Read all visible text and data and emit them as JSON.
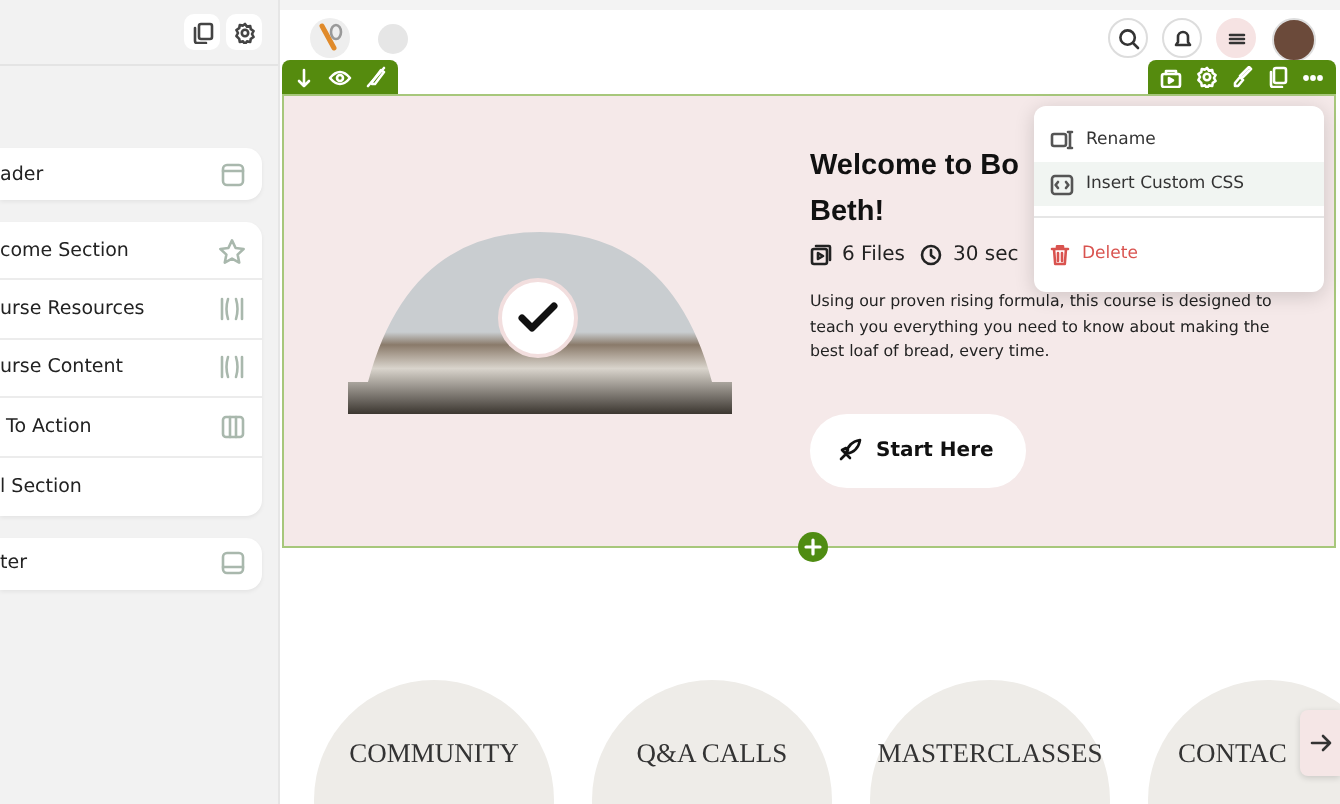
{
  "sidebar": {
    "groups": [
      {
        "items": [
          {
            "label": "ader",
            "kind": "header"
          }
        ]
      },
      {
        "items": [
          {
            "label": "come Section",
            "kind": "star"
          },
          {
            "label": "urse Resources",
            "kind": "columns"
          },
          {
            "label": "urse Content",
            "kind": "columns"
          },
          {
            "label": " To Action",
            "kind": "grid"
          },
          {
            "label": "l Section",
            "kind": "none"
          }
        ]
      },
      {
        "items": [
          {
            "label": "ter",
            "kind": "footer"
          }
        ]
      }
    ]
  },
  "hero": {
    "heading": "Welcome to Bo Beth!",
    "meta": [
      {
        "kind": "files",
        "text": "6 Files"
      },
      {
        "kind": "time",
        "text": "30 sec"
      }
    ],
    "description": "Using our proven rising formula, this course is designed to teach you everything you need to know about making the best loaf of bread, every time.",
    "button": "Start Here"
  },
  "context_menu": {
    "items": [
      {
        "kind": "rename",
        "label": "Rename",
        "selected": false
      },
      {
        "kind": "css",
        "label": "Insert Custom CSS",
        "selected": true
      },
      {
        "kind": "delete",
        "label": "Delete",
        "selected": false
      }
    ]
  },
  "categories": [
    {
      "label": "COMMUNITY"
    },
    {
      "label": "Q&A CALLS"
    },
    {
      "label": "MASTERCLASSES"
    },
    {
      "label": "CONTAC"
    }
  ]
}
